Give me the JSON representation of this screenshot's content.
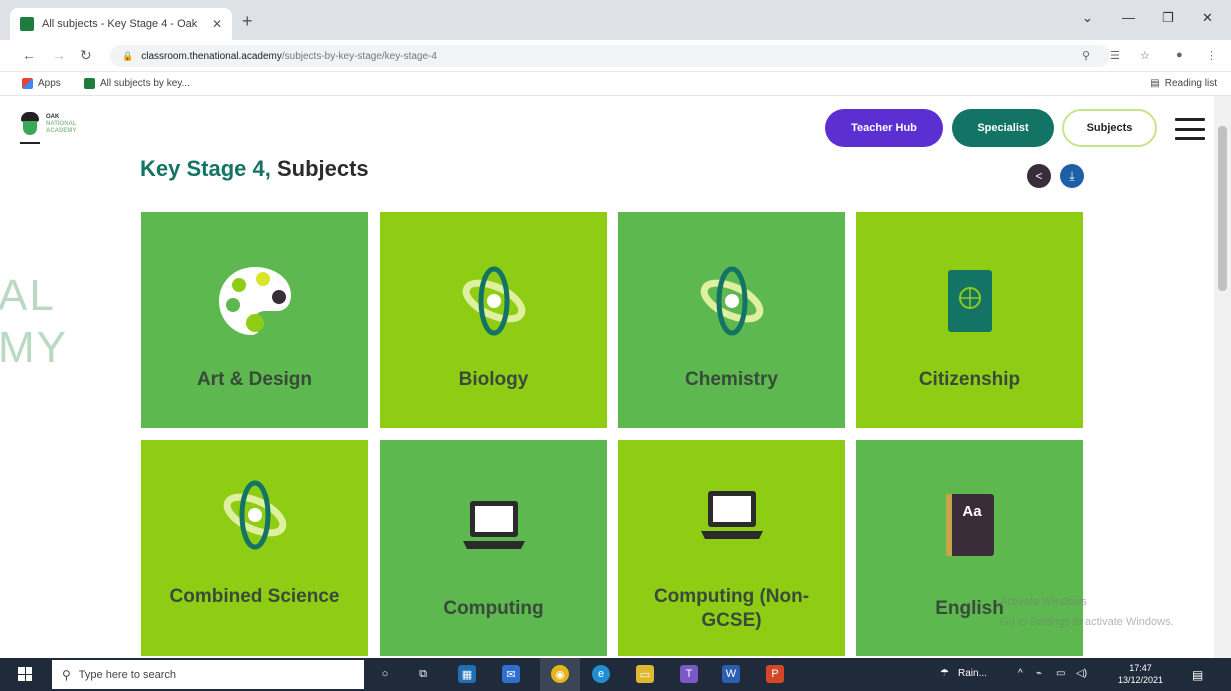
{
  "browser": {
    "tab_title": "All subjects - Key Stage 4 - Oak",
    "tab_close": "✕",
    "new_tab": "+",
    "url_host": "classroom.thenational.academy",
    "url_path": "/subjects-by-key-stage/key-stage-4",
    "bookmarks": [
      {
        "label": "Apps"
      },
      {
        "label": "All subjects by key..."
      }
    ],
    "reading_list": "Reading list"
  },
  "site": {
    "logo_top": "OAK",
    "logo_bottom": "NATIONAL ACADEMY",
    "nav": {
      "teacher_hub": "Teacher Hub",
      "specialist": "Specialist",
      "subjects": "Subjects"
    },
    "title_prefix": "Key Stage 4,",
    "title_suffix": " Subjects",
    "bg_letters": [
      "AL",
      "MY"
    ]
  },
  "subjects": [
    {
      "label": "Art & Design",
      "icon": "palette-icon"
    },
    {
      "label": "Biology",
      "icon": "atom-icon"
    },
    {
      "label": "Chemistry",
      "icon": "atom-icon"
    },
    {
      "label": "Citizenship",
      "icon": "passport-icon"
    },
    {
      "label": "Combined Science",
      "icon": "atom-icon"
    },
    {
      "label": "Computing",
      "icon": "laptop-icon"
    },
    {
      "label": "Computing (Non-GCSE)",
      "icon": "laptop-icon"
    },
    {
      "label": "English",
      "icon": "dictionary-icon"
    }
  ],
  "windows_overlay": [
    "Activate Windows",
    "Go to Settings to activate Windows."
  ],
  "taskbar": {
    "search_placeholder": "Type here to search",
    "tray_app": "Rain...",
    "time": "17:47",
    "date": "13/12/2021"
  },
  "colors": {
    "tile_green": "#5cb84f",
    "tile_lime": "#8fcd15",
    "teacher_hub": "#5b2fd1",
    "specialist": "#137364"
  }
}
